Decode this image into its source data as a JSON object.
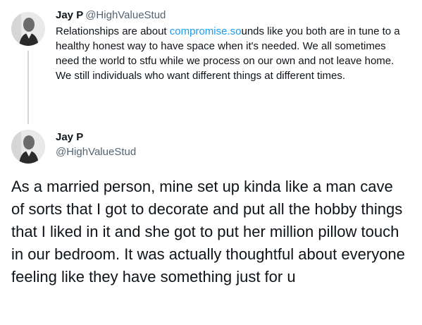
{
  "reply_tweet": {
    "author_name": "Jay P",
    "author_handle": "@HighValueStud",
    "text_before_link": "Relationships are about ",
    "link_text": "compromise.so",
    "text_after_link": "unds like you both are in tune to a healthy honest way to have space when it's needed. We all sometimes need the world to stfu while we process on our own and not leave home. We still individuals who want different things at different times."
  },
  "main_tweet": {
    "author_name": "Jay P",
    "author_handle": "@HighValueStud",
    "text": "As a married person, mine set up kinda like a man cave of sorts that I got to decorate and put all the hobby things that I liked in it and she got to put her million pillow touch in our bedroom. It was actually thoughtful about everyone feeling like they have something just for u"
  },
  "colors": {
    "link": "#1d9bf0",
    "handle": "#536471",
    "text": "#0f1419",
    "thread_line": "#cfd9de"
  },
  "icons": [
    "avatar-photo"
  ]
}
